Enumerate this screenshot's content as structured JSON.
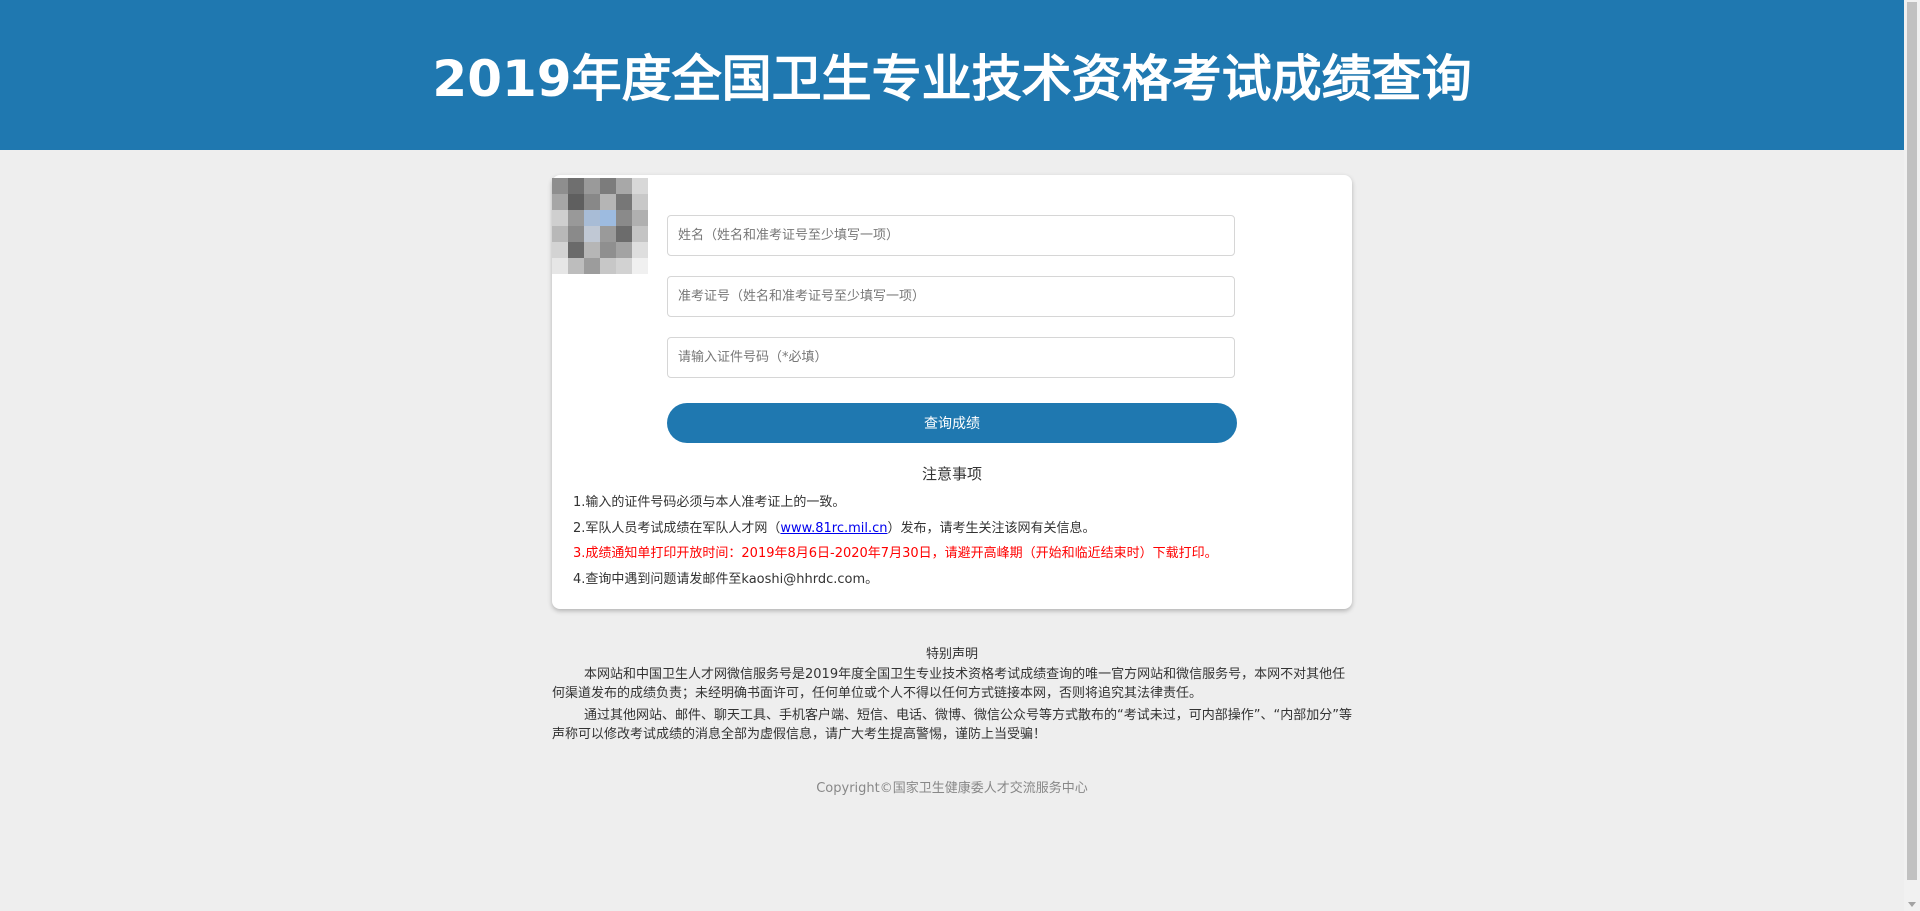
{
  "header": {
    "title": "2019年度全国卫生专业技术资格考试成绩查询"
  },
  "form": {
    "name_placeholder": "姓名（姓名和准考证号至少填写一项）",
    "ticket_placeholder": "准考证号（姓名和准考证号至少填写一项）",
    "id_placeholder": "请输入证件号码（*必填）",
    "submit_label": "查询成绩"
  },
  "notice": {
    "title": "注意事项",
    "item1": "1.输入的证件号码必须与本人准考证上的一致。",
    "item2_prefix": "2.军队人员考试成绩在军队人才网（",
    "item2_link": "www.81rc.mil.cn",
    "item2_suffix": "）发布，请考生关注该网有关信息。",
    "item3": "3.成绩通知单打印开放时间：2019年8月6日-2020年7月30日，请避开高峰期（开始和临近结束时）下载打印。",
    "item4": "4.查询中遇到问题请发邮件至kaoshi@hhrdc.com。"
  },
  "statement": {
    "title": "特别声明",
    "para1": "本网站和中国卫生人才网微信服务号是2019年度全国卫生专业技术资格考试成绩查询的唯一官方网站和微信服务号，本网不对其他任何渠道发布的成绩负责；未经明确书面许可，任何单位或个人不得以任何方式链接本网，否则将追究其法律责任。",
    "para2": "通过其他网站、邮件、聊天工具、手机客户端、短信、电话、微博、微信公众号等方式散布的“考试未过，可内部操作”、“内部加分”等声称可以修改考试成绩的消息全部为虚假信息，请广大考生提高警惕，谨防上当受骗！"
  },
  "footer": {
    "copyright": "Copyright©国家卫生健康委人才交流服务中心"
  },
  "colors": {
    "brand": "#1f78b0",
    "background": "#eeeeee",
    "warning": "#ff0000",
    "link": "#0000ee"
  },
  "avatar": {
    "icon": "pixelated-qr-code-icon"
  }
}
